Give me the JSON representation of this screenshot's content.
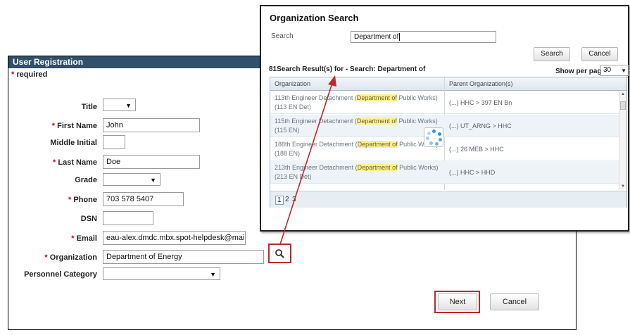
{
  "registration": {
    "header": "User Registration",
    "required_note": "required",
    "required_mark": "*",
    "fields": {
      "title": {
        "label": "Title",
        "value": ""
      },
      "first_name": {
        "label": "First Name",
        "value": "John"
      },
      "middle_initial": {
        "label": "Middle Initial",
        "value": ""
      },
      "last_name": {
        "label": "Last Name",
        "value": "Doe"
      },
      "grade": {
        "label": "Grade",
        "value": ""
      },
      "phone": {
        "label": "Phone",
        "value": "703 578 5407"
      },
      "dsn": {
        "label": "DSN",
        "value": ""
      },
      "email": {
        "label": "Email",
        "value": "eau-alex.dmdc.mbx.spot-helpdesk@mail.mil"
      },
      "organization": {
        "label": "Organization",
        "value": "Department of Energy"
      },
      "personnel_category": {
        "label": "Personnel Category",
        "value": ""
      }
    },
    "buttons": {
      "next": "Next",
      "cancel": "Cancel"
    }
  },
  "org_search": {
    "title": "Organization Search",
    "search_label": "Search",
    "search_value": "Department of",
    "buttons": {
      "search": "Search",
      "cancel": "Cancel"
    },
    "results_count": "81Search Result(s) for - Search: Department of",
    "per_page_label": "Show per page:",
    "per_page_value": "30",
    "columns": {
      "organization": "Organization",
      "parent": "Parent Organization(s)"
    },
    "rows": [
      {
        "pre": "113th Engineer Detachment (",
        "hl": "Department of",
        "post": " Public Works)(113 EN Det)",
        "parent": "(...) HHC > 397 EN Bn"
      },
      {
        "pre": "115th Engineer Detachment (",
        "hl": "Department of",
        "post": " Public Works)(115 EN)",
        "parent": "(...) UT_ARNG > HHC"
      },
      {
        "pre": "188th Engineer Detachment (",
        "hl": "Department of",
        "post": " Public Works)(188 EN)",
        "parent": "(...) 26 MEB > HHC"
      },
      {
        "pre": "213th Engineer Detachment (",
        "hl": "Department of",
        "post": " Public Works)(213 EN Det)",
        "parent": "(...) HHC > HHD"
      }
    ],
    "pages": [
      "1",
      "2",
      "3"
    ]
  },
  "colors": {
    "header_bg": "#2f4f6b",
    "required_star": "#cc0000",
    "highlight": "#fff08a",
    "annotation": "#c0282d",
    "spinner": "#3a8fd6"
  }
}
